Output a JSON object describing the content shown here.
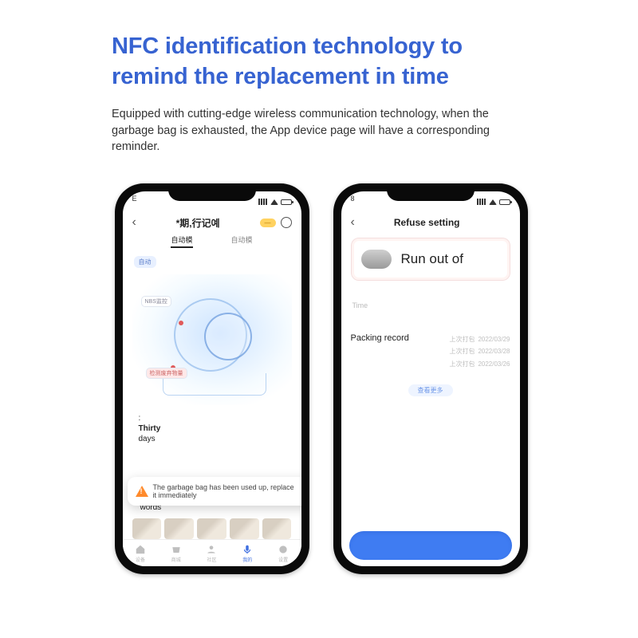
{
  "heading": "NFC identification technology to remind the replacement in time",
  "description": "Equipped with cutting-edge wireless communication technology, when the garbage bag is exhausted, the App device page will have a corresponding reminder.",
  "phone1": {
    "status_left": "E",
    "title": "*期,行记예",
    "badge": "—",
    "tabs": [
      "自动模",
      "自动模"
    ],
    "tag_text": "自动",
    "label_top": "NBS监控",
    "label_mid": "检测废弃物量",
    "stats_num": ":",
    "stats_unit": "Thirty",
    "stats_sub": "days",
    "alert_text": "The garbage bag has been used up, replace it immediately",
    "words": "words",
    "tabbar": [
      "设备",
      "商城",
      "社区",
      "我的",
      "设置"
    ]
  },
  "phone2": {
    "status_left": "8",
    "title": "Refuse setting",
    "card_text": "Run out of",
    "time_label": "Time",
    "packing_label": "Packing record",
    "records": [
      {
        "l": "上次打包",
        "d": "2022/03/29"
      },
      {
        "l": "上次打包",
        "d": "2022/03/28"
      },
      {
        "l": "上次打包",
        "d": "2022/03/26"
      }
    ],
    "more": "查看更多"
  }
}
